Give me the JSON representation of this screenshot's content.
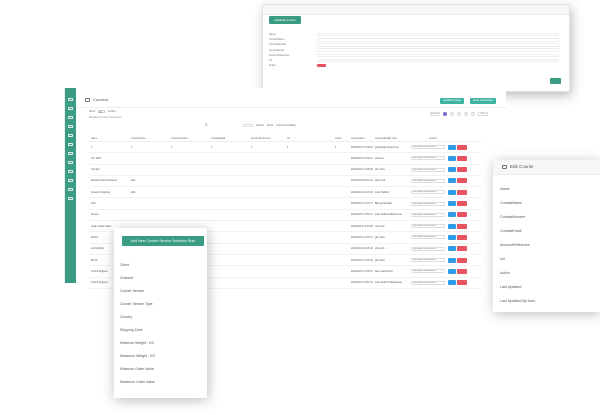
{
  "edit_window": {
    "badge": "Add/Edit Courier",
    "fields": [
      "Name",
      "ContactName",
      "ContactNumber",
      "ContactEmail",
      "AccountReference",
      "Url",
      "Active"
    ]
  },
  "main": {
    "title": "Couriers",
    "header_buttons": [
      "Add/Edit Courier",
      "Rules Add Courier"
    ],
    "show_label": "Show",
    "show_value": "10",
    "entries_label": "entries",
    "message": "Showing 1 to 10 of 10 entries",
    "search_label": "Search",
    "filter_label": "Show",
    "filter_options": "Columns Visibility",
    "pager": {
      "prev": "Previous",
      "pages": [
        "1",
        "2",
        "3",
        "4",
        "5"
      ],
      "next": "Next"
    },
    "columns": [
      "Name",
      "ContactName",
      "ContactNumber",
      "ContactEmail",
      "AccountReference",
      "Url",
      "Active",
      "LastUpdated",
      "LastUpdatedBy User",
      "Actions"
    ],
    "rows": [
      {
        "name": "1",
        "contact": "1",
        "number": "1",
        "email": "1",
        "ref": "1",
        "url": "1",
        "active": "1",
        "updated": "2019/02/14 10:38:10",
        "by": "graham@entertech.uk"
      },
      {
        "name": "Cur TEST",
        "contact": "",
        "number": "",
        "email": "",
        "ref": "",
        "url": "",
        "active": "",
        "updated": "2019/02/14 10:39:14",
        "by": "eFreeze"
      },
      {
        "name": "Citmatic",
        "contact": "",
        "number": "",
        "email": "",
        "ref": "",
        "url": "",
        "active": "",
        "updated": "2019/02/14 10:35:25",
        "by": "gbr.mdev"
      },
      {
        "name": "Rustik & Sons Delivered",
        "contact": "ahls",
        "number": "",
        "email": "",
        "ref": "",
        "url": "",
        "active": "",
        "updated": "2019/02/14 09:42:41",
        "by": "aidn.scott"
      },
      {
        "name": "Amazon Shipping",
        "contact": "ahls",
        "number": "",
        "email": "",
        "ref": "",
        "url": "",
        "active": "",
        "updated": "2019/02/14 11:13:44",
        "by": "Joan Stafford"
      },
      {
        "name": "APC",
        "contact": "",
        "number": "",
        "email": "",
        "ref": "",
        "url": "",
        "active": "",
        "updated": "2019/02/14 12:19:77",
        "by": "Bias gortschalet"
      },
      {
        "name": "Arrowx",
        "contact": "",
        "number": "",
        "email": "",
        "ref": "",
        "url": "",
        "active": "",
        "updated": "2019/02/14 10:51:17",
        "by": "Joan Stafford Warehouse"
      },
      {
        "name": "Asian Global Sales",
        "contact": "",
        "number": "",
        "email": "",
        "ref": "",
        "url": "",
        "active": "",
        "updated": "2019/02/14 11:00:08",
        "by": "phil.scott"
      },
      {
        "name": "Dorrite",
        "contact": "",
        "number": "",
        "email": "",
        "ref": "",
        "url": "",
        "active": "",
        "updated": "2019/02/14 12:40:17",
        "by": "gbr.mdev"
      },
      {
        "name": "ArchingPost",
        "contact": "",
        "number": "",
        "email": "",
        "ref": "",
        "url": "",
        "active": "",
        "updated": "2019/02/14 14:25:44",
        "by": "phil.scott"
      },
      {
        "name": "Binton",
        "contact": "",
        "number": "",
        "email": "",
        "ref": "",
        "url": "",
        "active": "",
        "updated": "2019/02/14 13:15:49",
        "by": "gbr.mdev"
      },
      {
        "name": "Oxford Register",
        "contact": "",
        "number": "",
        "email": "",
        "ref": "",
        "url": "",
        "active": "",
        "updated": "2019/02/14 17:05:07",
        "by": "alan.rowell.hostz"
      },
      {
        "name": "Oxford Register",
        "contact": "",
        "number": "",
        "email": "",
        "ref": "",
        "url": "",
        "active": "",
        "updated": "2019/02/14 10:57:14",
        "by": "Joan Stafford Warehouse"
      }
    ],
    "action_select": "warrington.courierhorizon"
  },
  "add_form": {
    "title": "Add New Courier Service Selection Rule",
    "fields": [
      "Client",
      "Channel",
      "Courier Service",
      "Courier Service Type",
      "Country",
      "Shipping Zone",
      "Minimum Weight - KG",
      "Maximum Weight - KG",
      "Minimum Order Value",
      "Maximum Order Value"
    ]
  },
  "edit_popup": {
    "title": "Edit Courier",
    "fields": [
      "Name",
      "ContactName",
      "ContactNumber",
      "ContactEmail",
      "AccountReference",
      "Url",
      "Active",
      "Last Updated",
      "Last Updated By User"
    ]
  },
  "colors": {
    "accent": "#3a9c83",
    "edit": "#2e9be6",
    "delete": "#e8535f",
    "page": "#6c63c7"
  }
}
